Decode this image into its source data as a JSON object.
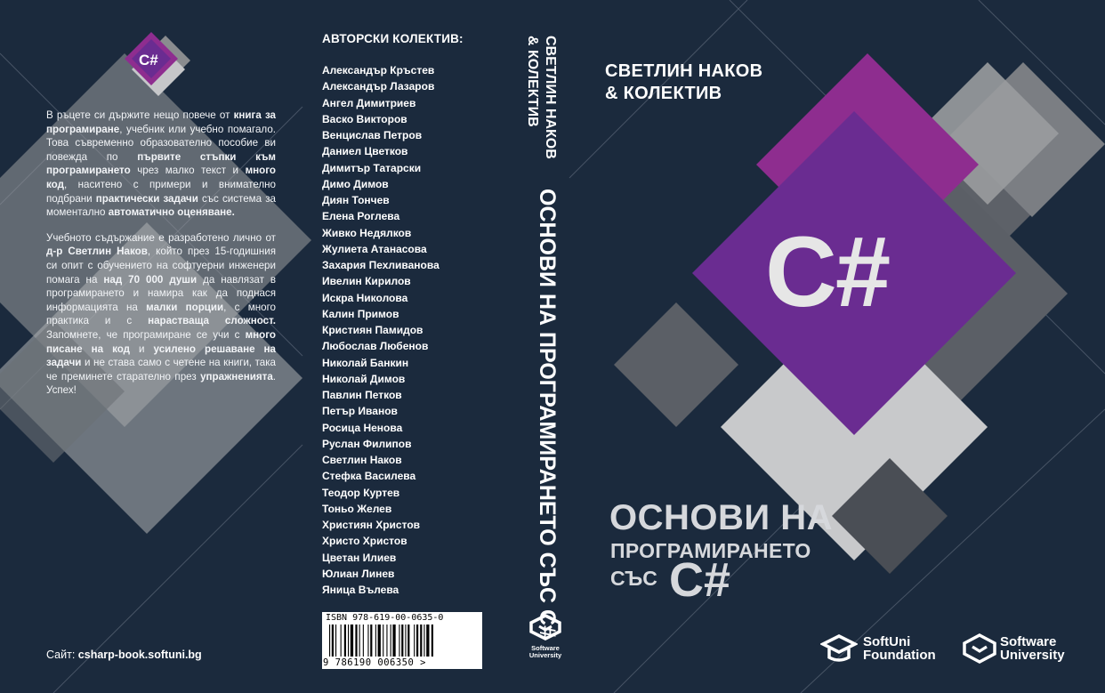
{
  "back": {
    "logo_text": "C#",
    "description_html": [
      "В ръцете си държите нещо повече от <b>книга за програмиране</b>, учебник или учебно помагало. Това съвременно образователно пособие ви повежда по <b>първите стъпки към програмирането</b> чрез малко текст и <b>много код</b>, наситено с примери и внимателно подбрани <b>практически задачи</b> със система за моментално <b>автоматично оценяване.</b>",
      "Учебното съдържание е разработено лично от <b>д-р Светлин Наков</b>, който през 15-годишния си опит с обучението на софтуерни инженери помага на <b>над 70 000 души</b> да навлязат в програмирането и намира как да поднася информацията на <b>малки порции</b>, с много практика и с <b>нарастваща сложност.</b> Запомнете, че програмиране се учи с <b>много писане на код</b> и <b>усилено решаване на задачи</b> и не става само с четене на книги, така че преминете старателно през <b>упражненията</b>. Успех!"
    ],
    "site_label": "Сайт:",
    "site_url": "csharp-book.softuni.bg",
    "authors_title": "АВТОРСКИ КОЛЕКТИВ:",
    "authors": [
      "Александър Кръстев",
      "Александър Лазаров",
      "Ангел Димитриев",
      "Васко Викторов",
      "Венцислав Петров",
      "Даниел Цветков",
      "Димитър Татарски",
      "Димо Димов",
      "Диян Тончев",
      "Елена Роглева",
      "Живко Недялков",
      "Жулиета Атанасова",
      "Захария Пехливанова",
      "Ивелин Кирилов",
      "Искра Николова",
      "Калин Примов",
      "Кристиян Памидов",
      "Любослав Любенов",
      "Николай Банкин",
      "Николай Димов",
      "Павлин Петков",
      "Петър Иванов",
      "Росица Ненова",
      "Руслан Филипов",
      "Светлин Наков",
      "Стефка Василева",
      "Теодор Куртев",
      "Тоньо Желев",
      "Християн Христов",
      "Христо Христов",
      "Цветан Илиев",
      "Юлиан Линев",
      "Яница Вълева"
    ],
    "isbn_text": "ISBN 978-619-00-0635-0",
    "barcode_digits": "9 786190 006350 >"
  },
  "spine": {
    "author": "СВЕТЛИН НАКОВ",
    "author2": "& КОЛЕКТИВ",
    "title": "ОСНОВИ НА ПРОГРАМИРАНЕТО СЪС C#",
    "logo_line1": "Software",
    "logo_line2": "University"
  },
  "front": {
    "author_line1": "СВЕТЛИН НАКОВ",
    "author_line2": "& КОЛЕКТИВ",
    "big_logo": "C#",
    "title_line1": "ОСНОВИ НА",
    "title_line2": "ПРОГРАМИРАНЕТО",
    "title_line3a": "СЪС",
    "title_line3b": "C#",
    "logo1_line1": "SoftUni",
    "logo1_line2": "Foundation",
    "logo2_line1": "Software",
    "logo2_line2": "University"
  },
  "colors": {
    "background": "#1b2a3d",
    "purple": "#6a2c91",
    "magenta": "#8e2d8f",
    "gray_light": "#c6c7c9",
    "gray_mid": "#8a8c8f",
    "gray_dark": "#4e535b"
  }
}
